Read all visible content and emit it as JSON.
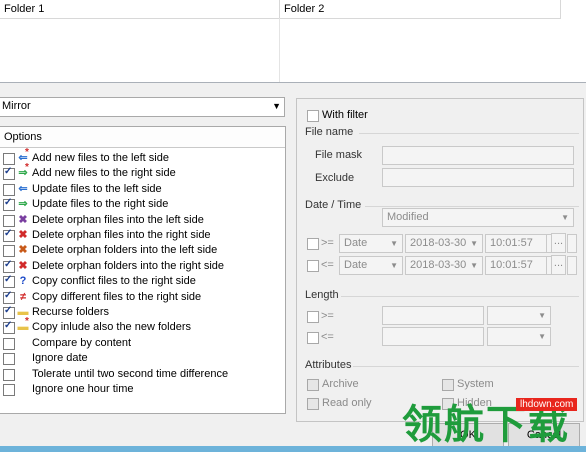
{
  "folders": {
    "col1": "Folder 1",
    "col2": "Folder 2"
  },
  "mode": {
    "value": "Mirror"
  },
  "options": {
    "header": "Options",
    "items": [
      {
        "label": "Add new files to the left side",
        "checked": false,
        "icon": "add-left-icon"
      },
      {
        "label": "Add new files to the right side",
        "checked": true,
        "icon": "add-right-icon"
      },
      {
        "label": "Update files to the left side",
        "checked": false,
        "icon": "update-left-icon"
      },
      {
        "label": "Update files to the right side",
        "checked": true,
        "icon": "update-right-icon"
      },
      {
        "label": "Delete orphan files into the left side",
        "checked": false,
        "icon": "delete-left-icon"
      },
      {
        "label": "Delete orphan files into the right side",
        "checked": true,
        "icon": "delete-right-icon"
      },
      {
        "label": "Delete orphan folders into the left side",
        "checked": false,
        "icon": "delete-folder-left-icon"
      },
      {
        "label": "Delete orphan folders into the right side",
        "checked": true,
        "icon": "delete-folder-right-icon"
      },
      {
        "label": "Copy conflict files to the right side",
        "checked": true,
        "icon": "question-icon"
      },
      {
        "label": "Copy different files to the right side",
        "checked": true,
        "icon": "not-equal-icon"
      },
      {
        "label": "Recurse folders",
        "checked": true,
        "icon": "folder-icon"
      },
      {
        "label": "Copy inlude also the new folders",
        "checked": true,
        "icon": "new-folder-icon"
      },
      {
        "label": "Compare by content",
        "checked": false,
        "icon": ""
      },
      {
        "label": "Ignore date",
        "checked": false,
        "icon": ""
      },
      {
        "label": "Tolerate until two second time difference",
        "checked": false,
        "icon": ""
      },
      {
        "label": "Ignore one hour time",
        "checked": false,
        "icon": ""
      }
    ]
  },
  "filter": {
    "with_filter": "With filter",
    "file_name": "File name",
    "file_mask": "File mask",
    "exclude": "Exclude",
    "date_time": "Date / Time",
    "modified": "Modified",
    "row1_op": ">=",
    "row2_op": "<=",
    "date_kind": "Date",
    "date_value": "2018-03-30",
    "time_value": "10:01:57",
    "ellipsis": "...",
    "length": "Length",
    "len_op1": ">=",
    "len_op2": "<=",
    "attributes": "Attributes",
    "archive": "Archive",
    "system": "System",
    "read_only": "Read only",
    "hidden": "Hidden"
  },
  "buttons": {
    "ok": "OK",
    "cancel": "Cancel"
  },
  "watermark": {
    "text": "领航下载",
    "url": "lhdown.com"
  }
}
